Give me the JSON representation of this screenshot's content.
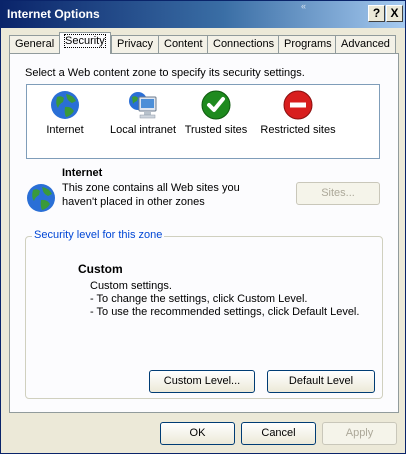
{
  "window": {
    "title": "Internet Options",
    "help_glyph": "?",
    "close_glyph": "X",
    "deco_glyph": "«"
  },
  "tabs": [
    "General",
    "Security",
    "Privacy",
    "Content",
    "Connections",
    "Programs",
    "Advanced"
  ],
  "active_tab": "Security",
  "zone_prompt": "Select a Web content zone to specify its security settings.",
  "zones": [
    {
      "label": "Internet",
      "icon": "globe-icon"
    },
    {
      "label": "Local intranet",
      "icon": "intranet-computer-icon"
    },
    {
      "label": "Trusted sites",
      "icon": "checkmark-icon"
    },
    {
      "label": "Restricted sites",
      "icon": "no-entry-icon"
    }
  ],
  "selected_zone": {
    "name": "Internet",
    "description": [
      "This zone contains all Web sites you",
      "haven't placed in other zones"
    ],
    "sites_button": "Sites..."
  },
  "security_level": {
    "group_title": "Security level for this zone",
    "level_name": "Custom",
    "lines": [
      "Custom settings.",
      "- To change the settings, click Custom Level.",
      "- To use the recommended settings, click Default Level."
    ],
    "custom_button": "Custom Level...",
    "default_button": "Default Level"
  },
  "footer": {
    "ok": "OK",
    "cancel": "Cancel",
    "apply": "Apply"
  },
  "colors": {
    "title_bar": "#0a246a",
    "face": "#ece9d8",
    "group_title": "#0046d5"
  }
}
